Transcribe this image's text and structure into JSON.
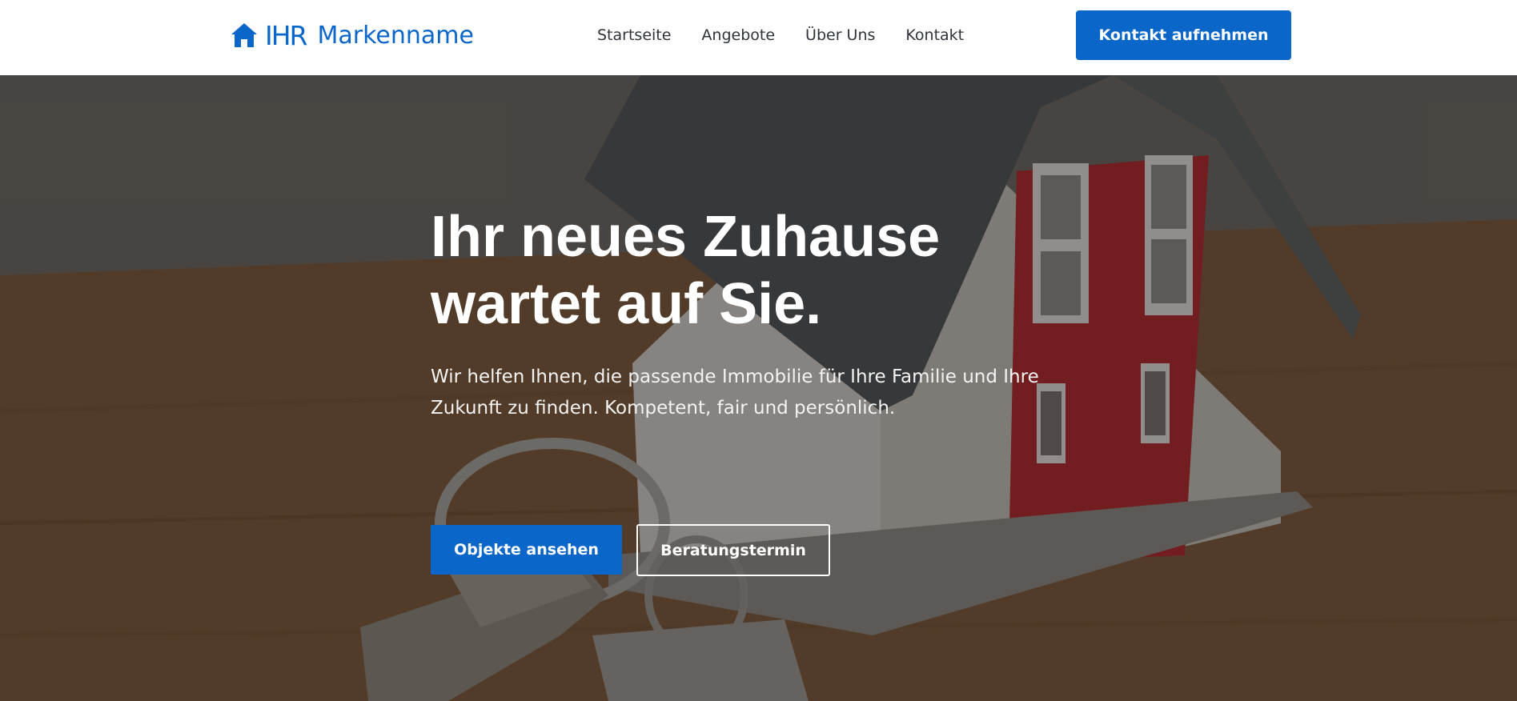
{
  "brand": {
    "mark": "IHR",
    "name": "Markenname",
    "icon": "house-icon",
    "color": "#0a66c8"
  },
  "nav": {
    "items": [
      {
        "label": "Startseite"
      },
      {
        "label": "Angebote"
      },
      {
        "label": "Über Uns"
      },
      {
        "label": "Kontakt"
      }
    ]
  },
  "header": {
    "cta_label": "Kontakt aufnehmen"
  },
  "hero": {
    "title_line1": "Ihr neues Zuhause",
    "title_line2": "wartet auf Sie.",
    "text": "Wir helfen Ihnen, die passende Immobilie für Ihre Familie und Ihre Zukunft zu finden. Kompetent, fair und persönlich.",
    "primary_button": "Objekte ansehen",
    "secondary_button": "Beratungstermin",
    "background_image": "model house with keys on wooden table"
  }
}
